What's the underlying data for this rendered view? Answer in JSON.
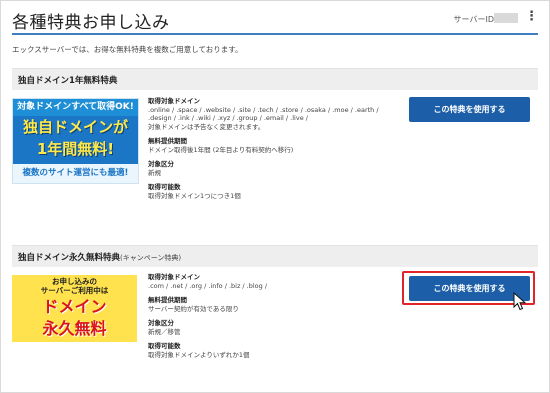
{
  "header": {
    "title": "各種特典お申し込み",
    "server_label": "サーバーID"
  },
  "intro_text": "エックスサーバーでは、お得な無料特典を複数ご用意しております。",
  "offer1": {
    "heading": "独自ドメイン1年無料特典",
    "banner": {
      "top": "対象ドメインすべて取得OK!",
      "line1": "独自ドメインが",
      "line2": "1年間無料!",
      "bottom": "複数のサイト運営にも最適!"
    },
    "target_domains_label": "取得対象ドメイン",
    "target_domains": ".online / .space / .website / .site / .tech / .store / .osaka / .moe / .earth / .design / .ink / .wiki / .xyz / .group / .email / .live /",
    "target_domains_note": "対象ドメインは予告なく変更されます。",
    "period_label": "無料提供期間",
    "period": "ドメイン取得後1年間 (2年目より有料契約へ移行)",
    "category_label": "対象区分",
    "category": "新規",
    "count_label": "取得可能数",
    "count": "取得対象ドメイン1つにつき1個",
    "button_label": "この特典を使用する"
  },
  "offer2": {
    "heading": "独自ドメイン永久無料特典",
    "heading_sub": "(キャンペーン特典)",
    "banner": {
      "top1": "お申し込みの",
      "top2": "サーバーご利用中は",
      "line1": "ドメイン",
      "line2": "永久無料"
    },
    "target_domains_label": "取得対象ドメイン",
    "target_domains": ".com / .net / .org / .info / .biz / .blog /",
    "period_label": "無料提供期間",
    "period": "サーバー契約が有効である限り",
    "category_label": "対象区分",
    "category": "新規／移管",
    "count_label": "取得可能数",
    "count": "取得対象ドメインよりいずれか1個",
    "button_label": "この特典を使用する"
  },
  "colors": {
    "accent": "#1c5fa8",
    "rule": "#3f7fc2",
    "highlight": "#e0242a"
  }
}
